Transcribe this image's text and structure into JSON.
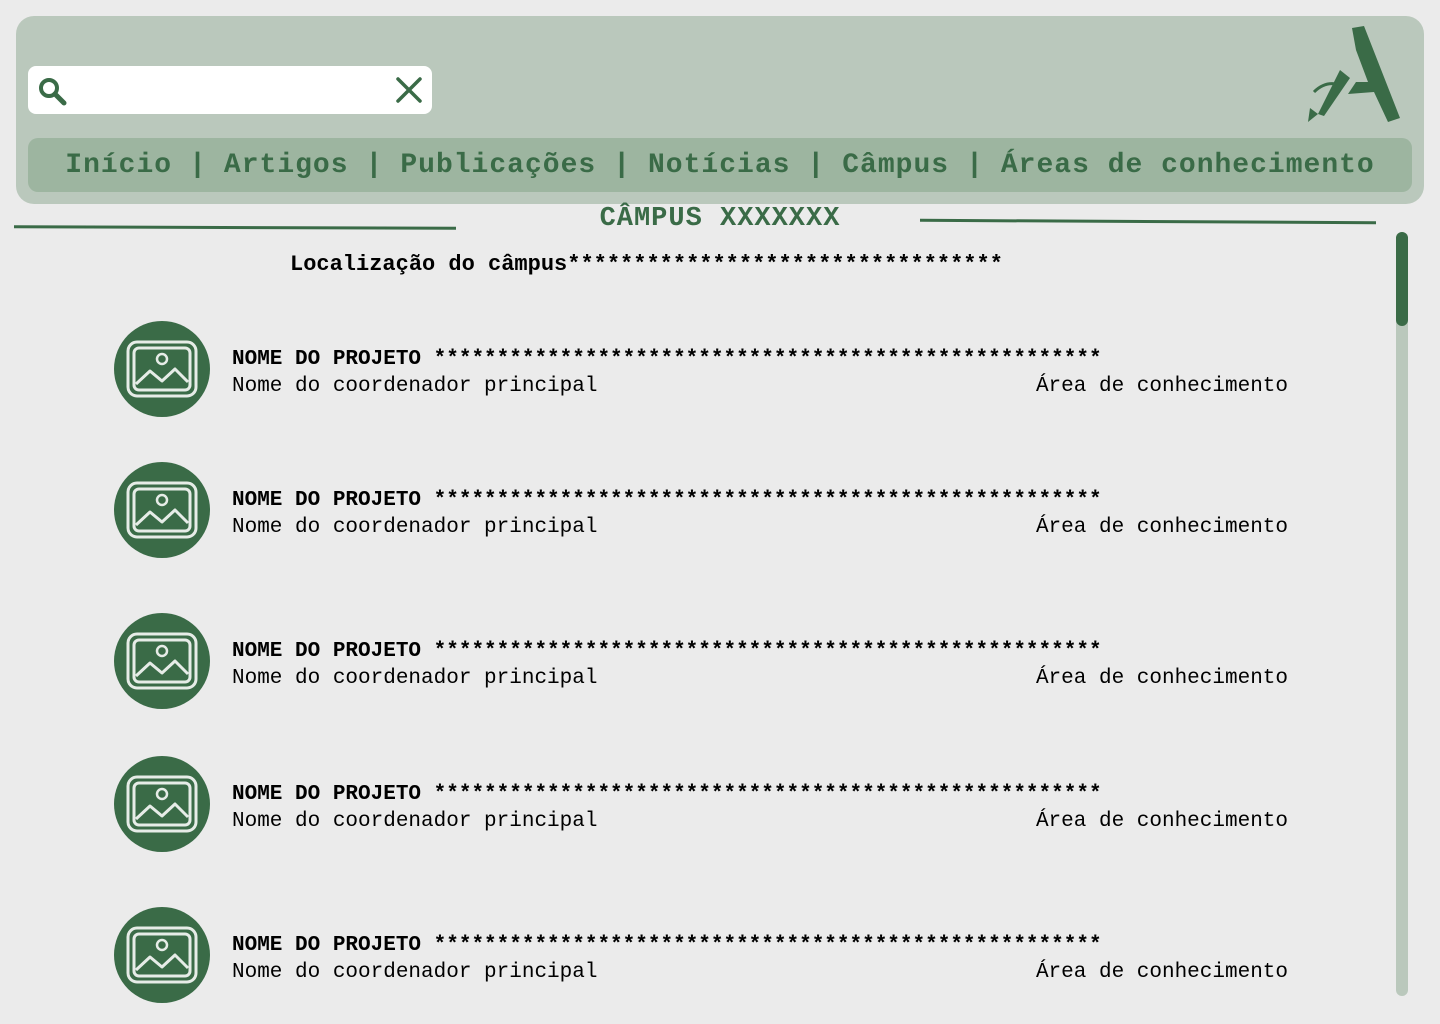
{
  "search": {
    "value": "",
    "placeholder": ""
  },
  "nav": {
    "items": [
      "Início",
      "Artigos",
      "Publicações",
      "Notícias",
      "Câmpus",
      "Áreas de conhecimento"
    ],
    "separator": "|"
  },
  "page": {
    "title": "CÂMPUS XXXXXXX",
    "location": "Localização do câmpus*********************************"
  },
  "projects": [
    {
      "name": "NOME DO PROJETO *****************************************************",
      "coordinator": "Nome do coordenador principal",
      "area": "Área de conhecimento"
    },
    {
      "name": "NOME DO PROJETO *****************************************************",
      "coordinator": "Nome do coordenador principal",
      "area": "Área de conhecimento"
    },
    {
      "name": "NOME DO PROJETO *****************************************************",
      "coordinator": "Nome do coordenador principal",
      "area": "Área de conhecimento"
    },
    {
      "name": "NOME DO PROJETO *****************************************************",
      "coordinator": "Nome do coordenador principal",
      "area": "Área de conhecimento"
    },
    {
      "name": "NOME DO PROJETO *****************************************************",
      "coordinator": "Nome do coordenador principal",
      "area": "Área de conhecimento"
    }
  ],
  "icons": {
    "search": "search-icon",
    "clear": "close-icon",
    "logo": "pen-letter-a-logo",
    "thumbnail": "image-placeholder-icon"
  },
  "colors": {
    "primary": "#3a6b47",
    "header_bg": "#bac8bc",
    "nav_bg": "#9db5a0",
    "page_bg": "#ebebeb"
  }
}
